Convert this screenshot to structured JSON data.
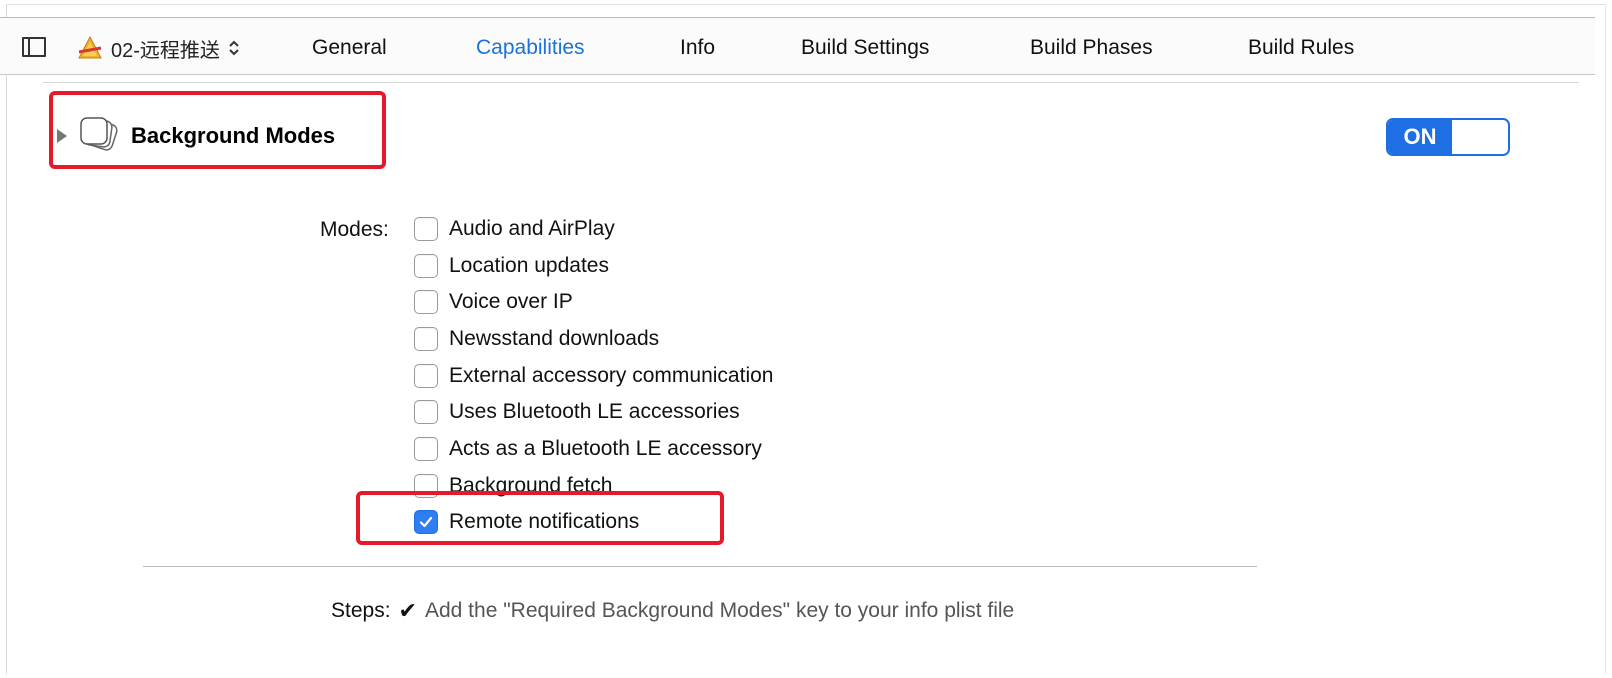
{
  "header": {
    "target_name": "02-远程推送",
    "tabs": [
      {
        "label": "General",
        "active": false
      },
      {
        "label": "Capabilities",
        "active": true
      },
      {
        "label": "Info",
        "active": false
      },
      {
        "label": "Build Settings",
        "active": false
      },
      {
        "label": "Build Phases",
        "active": false
      },
      {
        "label": "Build Rules",
        "active": false
      }
    ]
  },
  "capability": {
    "title": "Background Modes",
    "toggle_label": "ON",
    "toggle_state": "on",
    "modes_label": "Modes:",
    "modes": [
      {
        "label": "Audio and AirPlay",
        "checked": false
      },
      {
        "label": "Location updates",
        "checked": false
      },
      {
        "label": "Voice over IP",
        "checked": false
      },
      {
        "label": "Newsstand downloads",
        "checked": false
      },
      {
        "label": "External accessory communication",
        "checked": false
      },
      {
        "label": "Uses Bluetooth LE accessories",
        "checked": false
      },
      {
        "label": "Acts as a Bluetooth LE accessory",
        "checked": false
      },
      {
        "label": "Background fetch",
        "checked": false
      },
      {
        "label": "Remote notifications",
        "checked": true
      }
    ],
    "steps_label": "Steps:",
    "steps_icon": "checkmark",
    "steps": [
      {
        "text": "Add the \"Required Background Modes\" key to your info plist file"
      }
    ]
  },
  "colors": {
    "accent": "#1e6fe3",
    "active_tab": "#1a73d9",
    "highlight_box": "#e5192a"
  }
}
